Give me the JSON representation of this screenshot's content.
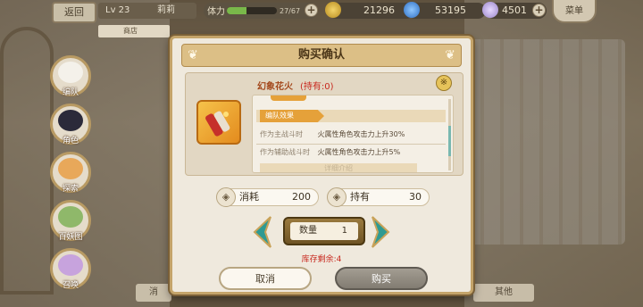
{
  "topbar": {
    "back_label": "返回",
    "level": "Lv 23",
    "player_name": "莉莉",
    "shop_label": "商店",
    "stamina_label": "体力",
    "stamina_value": "27/67",
    "stamina_fraction": 0.4,
    "gold": "21296",
    "gems": "53195",
    "crystals": "4501",
    "menu_label": "菜单"
  },
  "sidenav": {
    "items": [
      {
        "label": "编队",
        "icon": "formation-icon"
      },
      {
        "label": "角色",
        "icon": "character-icon"
      },
      {
        "label": "探索",
        "icon": "explore-icon"
      },
      {
        "label": "百妖图",
        "icon": "bestiary-icon"
      },
      {
        "label": "召唤",
        "icon": "summon-icon"
      }
    ]
  },
  "bottom_tabs": {
    "left": "消",
    "right": "其他"
  },
  "dialog": {
    "title": "购买确认",
    "item_name": "幻象花火",
    "owned_text": "(持有:0)",
    "info_icon": "info-icon",
    "effect_tab": "编队效果",
    "effects": [
      {
        "condition": "作为主战斗时",
        "text": "火属性角色攻击力上升30%"
      },
      {
        "condition": "作为辅助战斗时",
        "text": "火属性角色攻击力上升5%"
      }
    ],
    "more_text": "详细介绍",
    "cost_label": "消耗",
    "cost_value": "200",
    "own_label": "持有",
    "own_value": "30",
    "qty_label": "数量",
    "qty_value": "1",
    "stock_text": "库存剩余:4",
    "cancel_label": "取消",
    "buy_label": "购买"
  },
  "colors": {
    "accent_gold": "#c4a46a",
    "warning_red": "#c8281e"
  }
}
